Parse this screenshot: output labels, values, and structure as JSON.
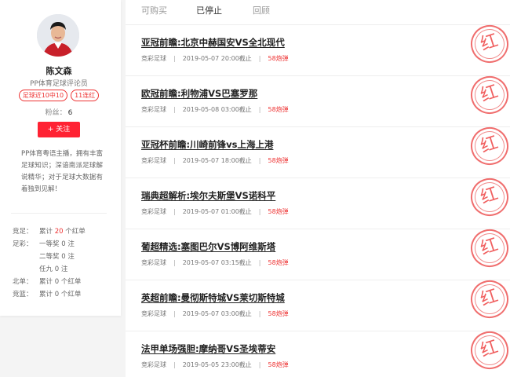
{
  "profile": {
    "name": "陈文森",
    "role": "PP体育足球评论员",
    "badges": [
      "足球近10中10",
      "11连红"
    ],
    "fans_label": "粉丝：",
    "fans_count": "6",
    "follow_label": "+ 关注",
    "bio": "PP体育粤语主播，拥有丰富足球知识；深谙南派足球解说精华；对于足球大数据有着独到见解！",
    "stats": [
      {
        "label": "竞足：",
        "prefix": "累计",
        "highlight": "20",
        "suffix": "个红单"
      },
      {
        "label": "足彩：",
        "prefix": "一等奖",
        "highlight": "",
        "suffix": "0 注"
      },
      {
        "label": "",
        "prefix": "二等奖",
        "highlight": "",
        "suffix": "0 注"
      },
      {
        "label": "",
        "prefix": "任九",
        "highlight": "",
        "suffix": "0 注"
      },
      {
        "label": "北单：",
        "prefix": "累计",
        "highlight": "",
        "suffix": "0 个红单"
      },
      {
        "label": "竞篮：",
        "prefix": "累计",
        "highlight": "",
        "suffix": "0 个红单"
      }
    ]
  },
  "tabs": [
    "可购买",
    "已停止",
    "回顾"
  ],
  "items": [
    {
      "title": "亚冠前瞻:北京中赫国安VS全北现代",
      "category": "竞彩足球",
      "deadline": "2019-05-07 20:00截止",
      "price": "58炮弹",
      "stamp": "红"
    },
    {
      "title": "欧冠前瞻:利物浦VS巴塞罗那",
      "category": "竞彩足球",
      "deadline": "2019-05-08 03:00截止",
      "price": "58炮弹",
      "stamp": "红"
    },
    {
      "title": "亚冠杯前瞻:川崎前锋vs上海上港",
      "category": "竞彩足球",
      "deadline": "2019-05-07 18:00截止",
      "price": "58炮弹",
      "stamp": "红"
    },
    {
      "title": "瑞典超解析:埃尔夫斯堡VS诺科平",
      "category": "竞彩足球",
      "deadline": "2019-05-07 01:00截止",
      "price": "58炮弹",
      "stamp": "红"
    },
    {
      "title": "葡超精选:塞图巴尔VS博阿维斯塔",
      "category": "竞彩足球",
      "deadline": "2019-05-07 03:15截止",
      "price": "58炮弹",
      "stamp": "红"
    },
    {
      "title": "英超前瞻:曼彻斯特城VS莱切斯特城",
      "category": "竞彩足球",
      "deadline": "2019-05-07 03:00截止",
      "price": "58炮弹",
      "stamp": "红"
    },
    {
      "title": "法甲单场强胆:摩纳哥VS圣埃蒂安",
      "category": "竞彩足球",
      "deadline": "2019-05-05 23:00截止",
      "price": "58炮弹",
      "stamp": "红"
    }
  ]
}
